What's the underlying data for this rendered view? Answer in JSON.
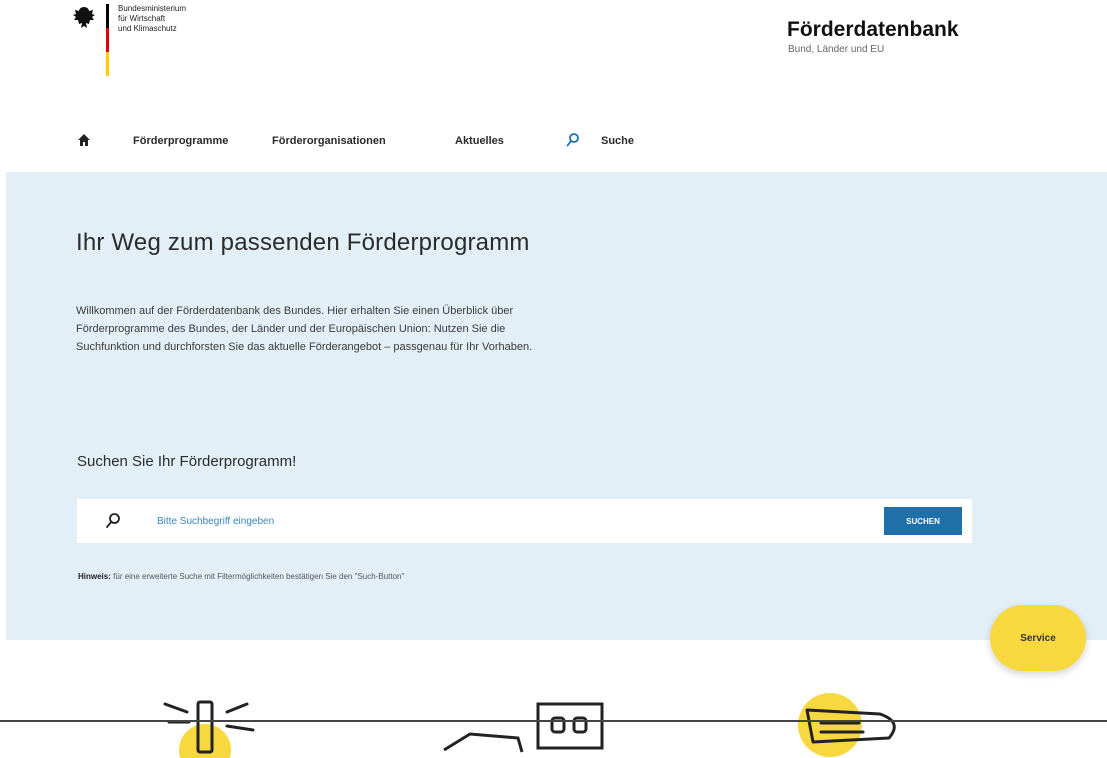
{
  "header": {
    "ministry_lines": [
      "Bundesministerium",
      "für Wirtschaft",
      "und Klimaschutz"
    ],
    "brand_title": "Förderdatenbank",
    "brand_subtitle": "Bund, Länder und EU"
  },
  "nav": {
    "home_icon": "home-icon",
    "items": [
      {
        "label": "Förderprogramme"
      },
      {
        "label": "Förderorganisationen"
      },
      {
        "label": "Aktuelles"
      },
      {
        "label": "Suche"
      }
    ]
  },
  "hero": {
    "title": "Ihr Weg zum passenden Förderprogramm",
    "intro_lines": [
      "Willkommen auf der Förderdatenbank des Bundes. Hier erhalten Sie einen Überblick über",
      "Förderprogramme des Bundes, der Länder und der Europäischen Union: Nutzen Sie die",
      "Suchfunktion und durchforsten Sie das aktuelle Förderangebot – passgenau für Ihr Vorhaben."
    ],
    "search_heading": "Suchen Sie Ihr Förderprogramm!",
    "search": {
      "placeholder": "Bitte Suchbegriff eingeben",
      "value": "",
      "button_label": "SUCHEN"
    },
    "hint_label": "Hinweis:",
    "hint_text": "für eine erweiterte Suche mit Filtermöglichkeiten bestätigen Sie den \"Such-Button\""
  },
  "service": {
    "label": "Service"
  },
  "colors": {
    "hero_bg": "#e3eff6",
    "accent_blue": "#1f6fa8",
    "service_yellow": "#f7d83f",
    "flag_black": "#000000",
    "flag_red": "#dd0000",
    "flag_gold": "#ffce00"
  }
}
